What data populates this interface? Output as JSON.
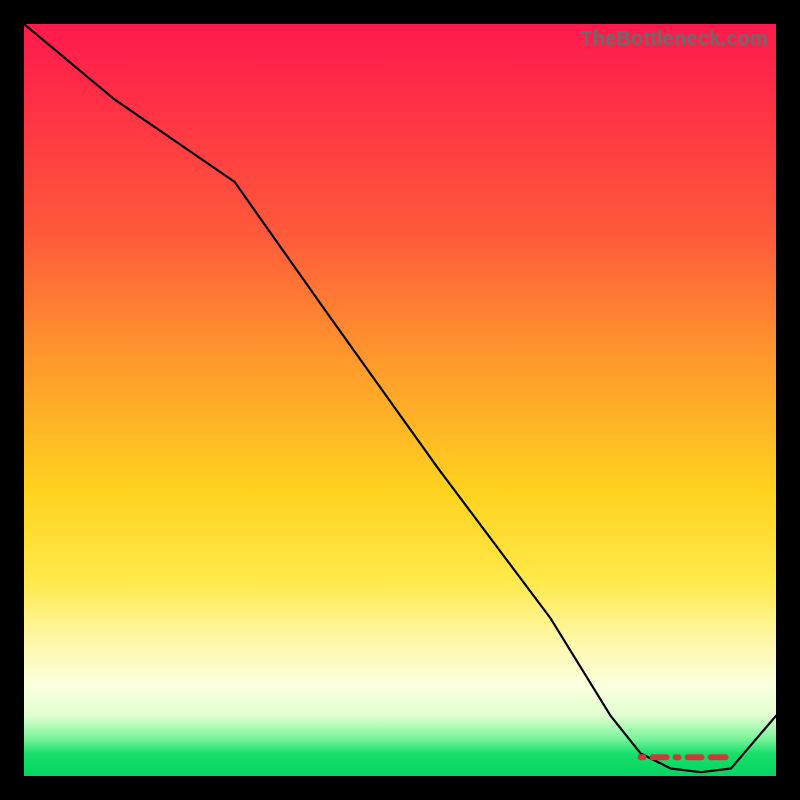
{
  "watermark": "TheBottleneck.com",
  "chart_data": {
    "type": "line",
    "title": "",
    "xlabel": "",
    "ylabel": "",
    "xlim": [
      0,
      100
    ],
    "ylim": [
      0,
      100
    ],
    "grid": false,
    "series": [
      {
        "name": "bottleneck-curve",
        "x": [
          0,
          12,
          28,
          40,
          55,
          70,
          78,
          82,
          86,
          90,
          94,
          100
        ],
        "y": [
          100,
          90,
          79,
          62,
          41,
          21,
          8,
          3,
          1,
          0.5,
          1,
          8
        ]
      },
      {
        "name": "optimal-range-marker",
        "x": [
          82,
          94
        ],
        "y": [
          2.5,
          2.5
        ]
      }
    ],
    "optimal_range": {
      "start_pct": 82,
      "end_pct": 94
    },
    "background_gradient": {
      "top": "#ff1a4c",
      "mid": "#ffd21e",
      "bottom": "#04d463"
    }
  },
  "colors": {
    "curve": "#000000",
    "marker": "#cc3a3a",
    "frame": "#000000"
  }
}
